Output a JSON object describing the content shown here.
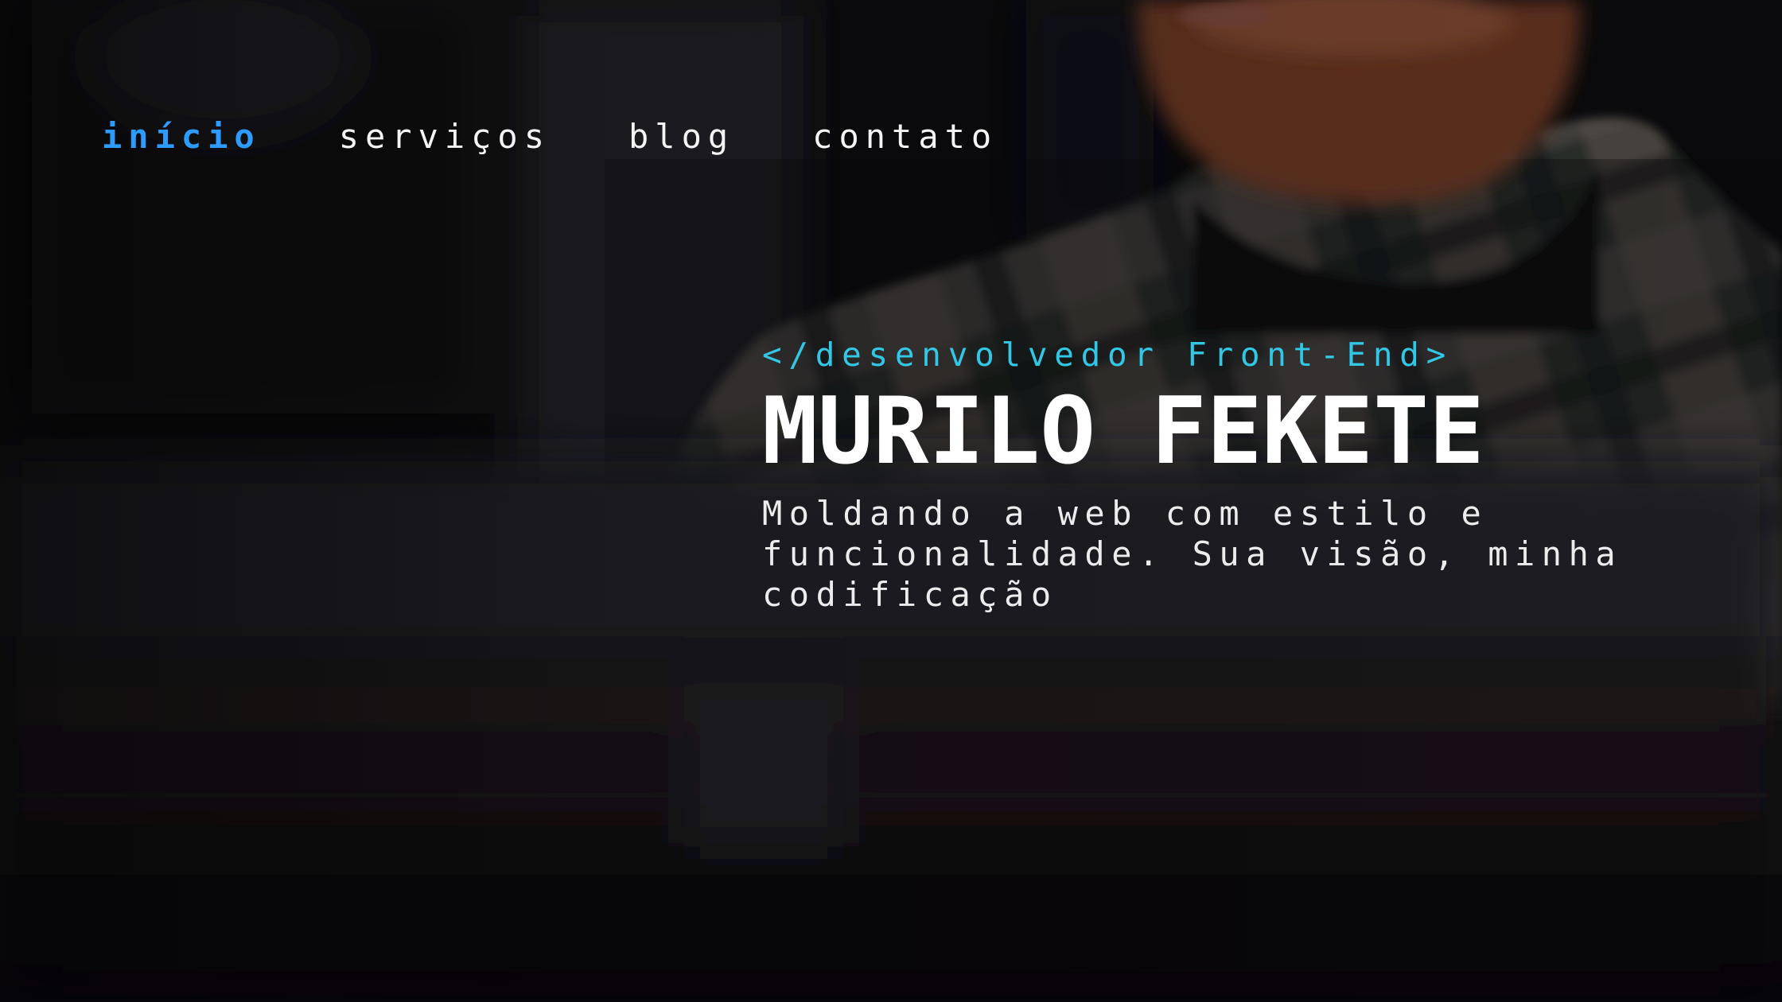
{
  "nav": {
    "items": [
      {
        "label": "início",
        "active": true
      },
      {
        "label": "serviços",
        "active": false
      },
      {
        "label": "blog",
        "active": false
      },
      {
        "label": "contato",
        "active": false
      }
    ]
  },
  "hero": {
    "role": "</desenvolvedor Front-End>",
    "name": "MURILO FEKETE",
    "tagline": "Moldando a web com estilo e funcionalidade. Sua visão, minha codificação"
  },
  "colors": {
    "accent_blue": "#2e9bff",
    "accent_cyan": "#33c7e6",
    "text": "#ffffff",
    "background": "#08080a"
  }
}
